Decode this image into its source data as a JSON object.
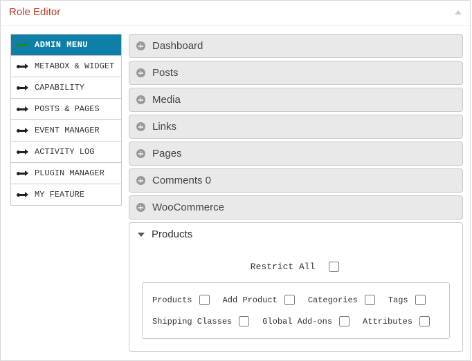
{
  "header": {
    "title": "Role Editor"
  },
  "sidebar": {
    "items": [
      {
        "label": "ADMIN MENU",
        "active": true
      },
      {
        "label": "METABOX & WIDGET",
        "active": false
      },
      {
        "label": "CAPABILITY",
        "active": false
      },
      {
        "label": "POSTS & PAGES",
        "active": false
      },
      {
        "label": "EVENT MANAGER",
        "active": false
      },
      {
        "label": "ACTIVITY LOG",
        "active": false
      },
      {
        "label": "PLUGIN MANAGER",
        "active": false
      },
      {
        "label": "MY FEATURE",
        "active": false
      }
    ]
  },
  "accordion": {
    "closed": [
      {
        "label": "Dashboard"
      },
      {
        "label": "Posts"
      },
      {
        "label": "Media"
      },
      {
        "label": "Links"
      },
      {
        "label": "Pages"
      },
      {
        "label": "Comments 0"
      },
      {
        "label": "WooCommerce"
      }
    ],
    "open": {
      "label": "Products",
      "restrict_label": "Restrict All",
      "restrict_checked": false,
      "permissions": [
        {
          "label": "Products",
          "checked": false
        },
        {
          "label": "Add Product",
          "checked": false
        },
        {
          "label": "Categories",
          "checked": false
        },
        {
          "label": "Tags",
          "checked": false
        },
        {
          "label": "Shipping Classes",
          "checked": false
        },
        {
          "label": "Global Add-ons",
          "checked": false
        },
        {
          "label": "Attributes",
          "checked": false
        }
      ]
    }
  },
  "colors": {
    "header_title": "#b73a2c",
    "sidebar_active_bg": "#0e7fa8"
  }
}
